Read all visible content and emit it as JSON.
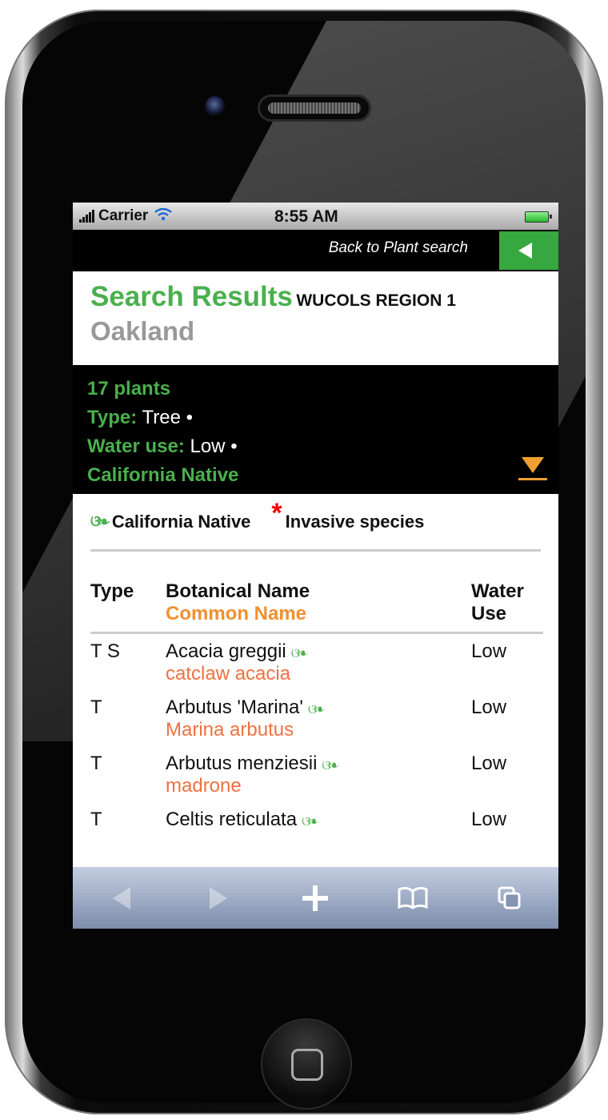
{
  "status_bar": {
    "carrier": "Carrier",
    "time": "8:55 AM"
  },
  "nav": {
    "back_label": "Back to Plant search"
  },
  "header": {
    "title": "Search Results",
    "region": "WUCOLS REGION 1",
    "city": "Oakland"
  },
  "filters": {
    "count": "17 plants",
    "type_label": "Type:",
    "type_value": "Tree",
    "water_label": "Water use:",
    "water_value": "Low",
    "native": "California Native",
    "separator": "•"
  },
  "legend": {
    "native": "California Native",
    "invasive": "Invasive species",
    "invasive_marker": "*"
  },
  "table": {
    "headers": {
      "type": "Type",
      "botanical": "Botanical Name",
      "common": "Common Name",
      "water1": "Water",
      "water2": "Use"
    },
    "rows": [
      {
        "type": "T S",
        "botanical": "Acacia greggii",
        "common": "catclaw acacia",
        "water": "Low"
      },
      {
        "type": "T",
        "botanical": "Arbutus 'Marina'",
        "common": "Marina arbutus",
        "water": "Low"
      },
      {
        "type": "T",
        "botanical": "Arbutus menziesii",
        "common": "madrone",
        "water": "Low"
      },
      {
        "type": "T",
        "botanical": "Celtis reticulata",
        "common": "",
        "water": "Low"
      }
    ]
  },
  "icons": {
    "native_leaf": "leaf-icon",
    "back": "triangle-left-icon",
    "collapse": "triangle-down-icon"
  },
  "colors": {
    "accent_green": "#4ab04d",
    "accent_orange": "#f09030",
    "common_name": "#f07040"
  }
}
